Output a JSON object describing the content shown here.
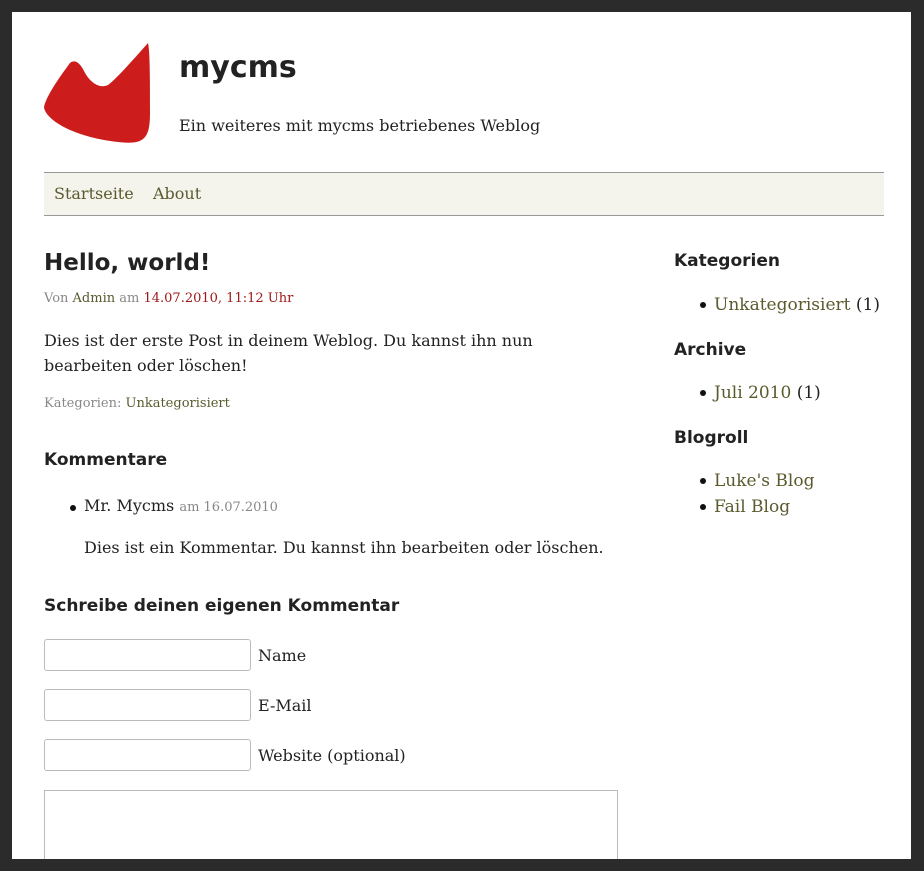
{
  "site": {
    "title": "mycms",
    "tagline": "Ein weiteres mit mycms betriebenes Weblog",
    "logo_color": "#cc1c1c"
  },
  "nav": {
    "items": [
      {
        "label": "Startseite"
      },
      {
        "label": "About"
      }
    ]
  },
  "post": {
    "title": "Hello, world!",
    "meta_by": "Von",
    "author": "Admin",
    "meta_on": "am",
    "date": "14.07.2010, 11:12 Uhr",
    "body": "Dies ist der erste Post in deinem Weblog. Du kannst ihn nun bearbeiten oder löschen!",
    "categories_label": "Kategorien:",
    "category": "Unkategorisiert"
  },
  "comments": {
    "heading": "Kommentare",
    "items": [
      {
        "author": "Mr. Mycms",
        "date": "am 16.07.2010",
        "text": "Dies ist ein Kommentar. Du kannst ihn bearbeiten oder löschen."
      }
    ]
  },
  "comment_form": {
    "heading": "Schreibe deinen eigenen Kommentar",
    "name_label": "Name",
    "email_label": "E-Mail",
    "website_label": "Website (optional)",
    "name_value": "",
    "email_value": "",
    "website_value": ""
  },
  "sidebar": {
    "categories": {
      "heading": "Kategorien",
      "items": [
        {
          "label": "Unkategorisiert",
          "count": "(1)"
        }
      ]
    },
    "archive": {
      "heading": "Archive",
      "items": [
        {
          "label": "Juli 2010",
          "count": "(1)"
        }
      ]
    },
    "blogroll": {
      "heading": "Blogroll",
      "items": [
        {
          "label": "Luke's Blog"
        },
        {
          "label": "Fail Blog"
        }
      ]
    }
  },
  "colors": {
    "link": "#5a5a2e",
    "date": "#a01818",
    "nav_bg": "#f4f4ec"
  }
}
